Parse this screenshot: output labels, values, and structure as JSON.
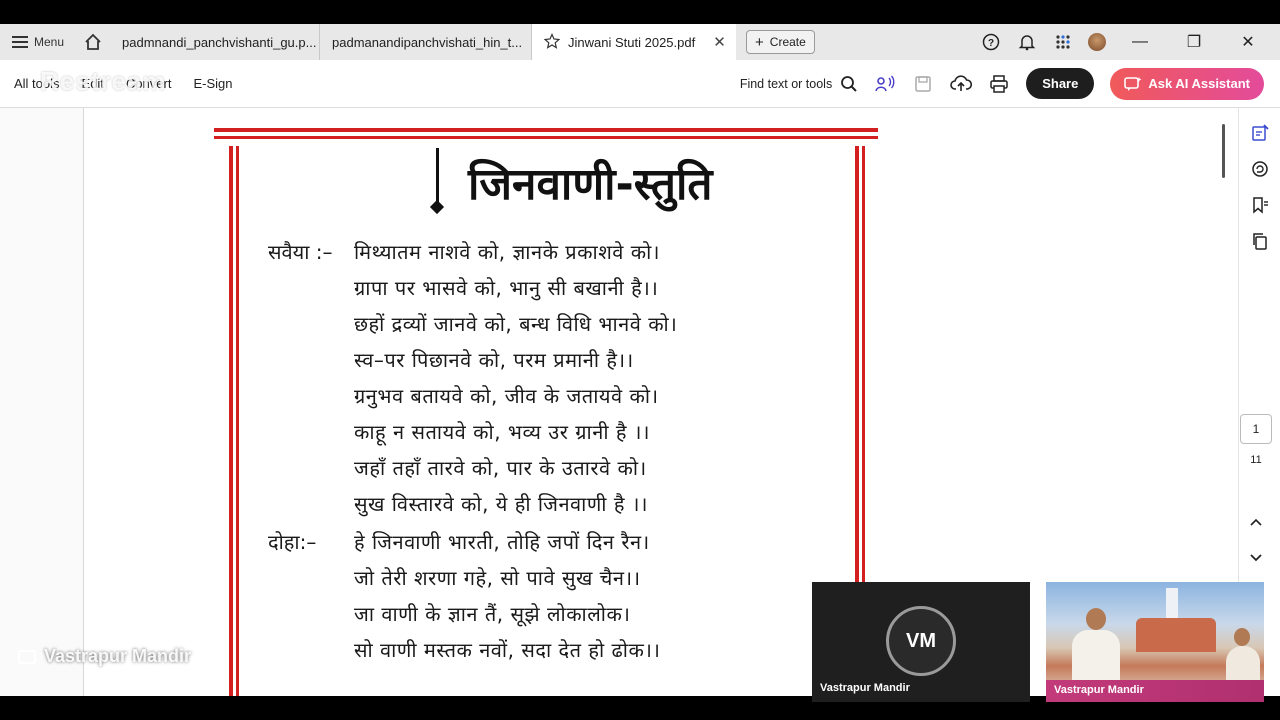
{
  "tabbar": {
    "menu_label": "Menu",
    "tabs": [
      {
        "title": "padmnandi_panchvishanti_gu.p..."
      },
      {
        "title": "padmanandipanchvishati_hin_t..."
      },
      {
        "title": "Jinwani Stuti 2025.pdf"
      }
    ],
    "create_label": "Create"
  },
  "toolbar": {
    "menu": [
      "All tools",
      "Edit",
      "Convert",
      "E-Sign"
    ],
    "find_label": "Find text or tools",
    "share_label": "Share",
    "ai_label": "Ask AI Assistant"
  },
  "pager": {
    "current_page": "1",
    "total_pages": "11"
  },
  "pdf": {
    "title": "जिनवाणी-स्तुति",
    "savaiya_label": "सवैया :–",
    "doha_label": "दोहा:–",
    "savaiya_lines": [
      "मिथ्यातम  नाशवे  को, ज्ञानके प्रकाशवे को।",
      "ग्रापा  पर  भासवे  को, भानु सी बखानी है।।",
      "छहों द्रव्यों जानवे को, बन्ध विधि भानवे को।",
      "स्व–पर   पिछानवे  को,  परम  प्रमानी है।।",
      "ग्रनुभव  बतायवे  को, जीव के जतायवे को।",
      "काहू न  सतायवे  को,  भव्य उर ग्रानी है ।।",
      "जहाँ तहाँ  तारवे  को, पार के उतारवे को।",
      "सुख  विस्तारवे  को, ये ही जिनवाणी  है ।।"
    ],
    "doha_lines": [
      "हे जिनवाणी  भारती,  तोहि जपों दिन रैन।",
      "जो तेरी  शरणा गहे, सो  पावे  सुख  चैन।।",
      "जा वाणी  के  ज्ञान  तैं,  सूझे  लोकालोक।",
      "सो वाणी मस्तक नवों, सदा देत  हो ढोक।।"
    ]
  },
  "overlay": {
    "watermark": "Restream",
    "source_label": "Vastrapur Mandir",
    "tile_initials": "VM",
    "tile1_name": "Vastrapur Mandir",
    "tile2_name": "Vastrapur Mandir"
  },
  "colors": {
    "accent_red": "#d21f1f",
    "share_bg": "#1e1e1e",
    "ai_gradient_start": "#f05a5a",
    "ai_gradient_end": "#e34b9b"
  }
}
